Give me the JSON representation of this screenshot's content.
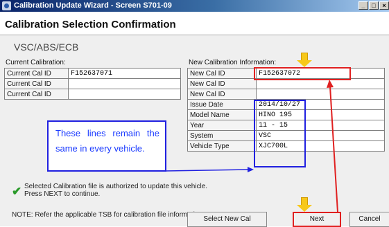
{
  "window": {
    "title": "Calibration Update Wizard - Screen S701-09",
    "buttons": {
      "minimize": "_",
      "maximize": "□",
      "close": "×"
    }
  },
  "header": {
    "title": "Calibration Selection Confirmation"
  },
  "module": "VSC/ABS/ECB",
  "current": {
    "label": "Current Calibration:",
    "rows": [
      {
        "key": "Current Cal ID",
        "value": "F152637071"
      },
      {
        "key": "Current Cal ID",
        "value": ""
      },
      {
        "key": "Current Cal ID",
        "value": ""
      }
    ]
  },
  "new_info": {
    "label": "New Calibration Information:",
    "rows": [
      {
        "key": "New Cal ID",
        "value": "F152637072"
      },
      {
        "key": "New Cal ID",
        "value": ""
      },
      {
        "key": "New Cal ID",
        "value": ""
      },
      {
        "key": "Issue Date",
        "value": "2014/10/27"
      },
      {
        "key": "Model Name",
        "value": "HINO 195"
      },
      {
        "key": "Year",
        "value": "11 - 15"
      },
      {
        "key": "System",
        "value": "VSC"
      },
      {
        "key": "Vehicle Type",
        "value": "XJC700L"
      }
    ]
  },
  "annotation": {
    "lines": [
      "These lines remain the",
      "same in every vehicle."
    ]
  },
  "message": {
    "line1": "Selected Calibration file is authorized to update this vehicle.",
    "line2": "Press NEXT to continue."
  },
  "note": "NOTE: Refer the applicable TSB for calibration file information.",
  "buttons": {
    "select_new": "Select New Cal",
    "next": "Next",
    "cancel": "Cancel"
  },
  "colors": {
    "highlight_blue": "#2020e0",
    "highlight_red": "#e02020",
    "arrow": "#f7c81a",
    "check": "#2a9a2a"
  }
}
